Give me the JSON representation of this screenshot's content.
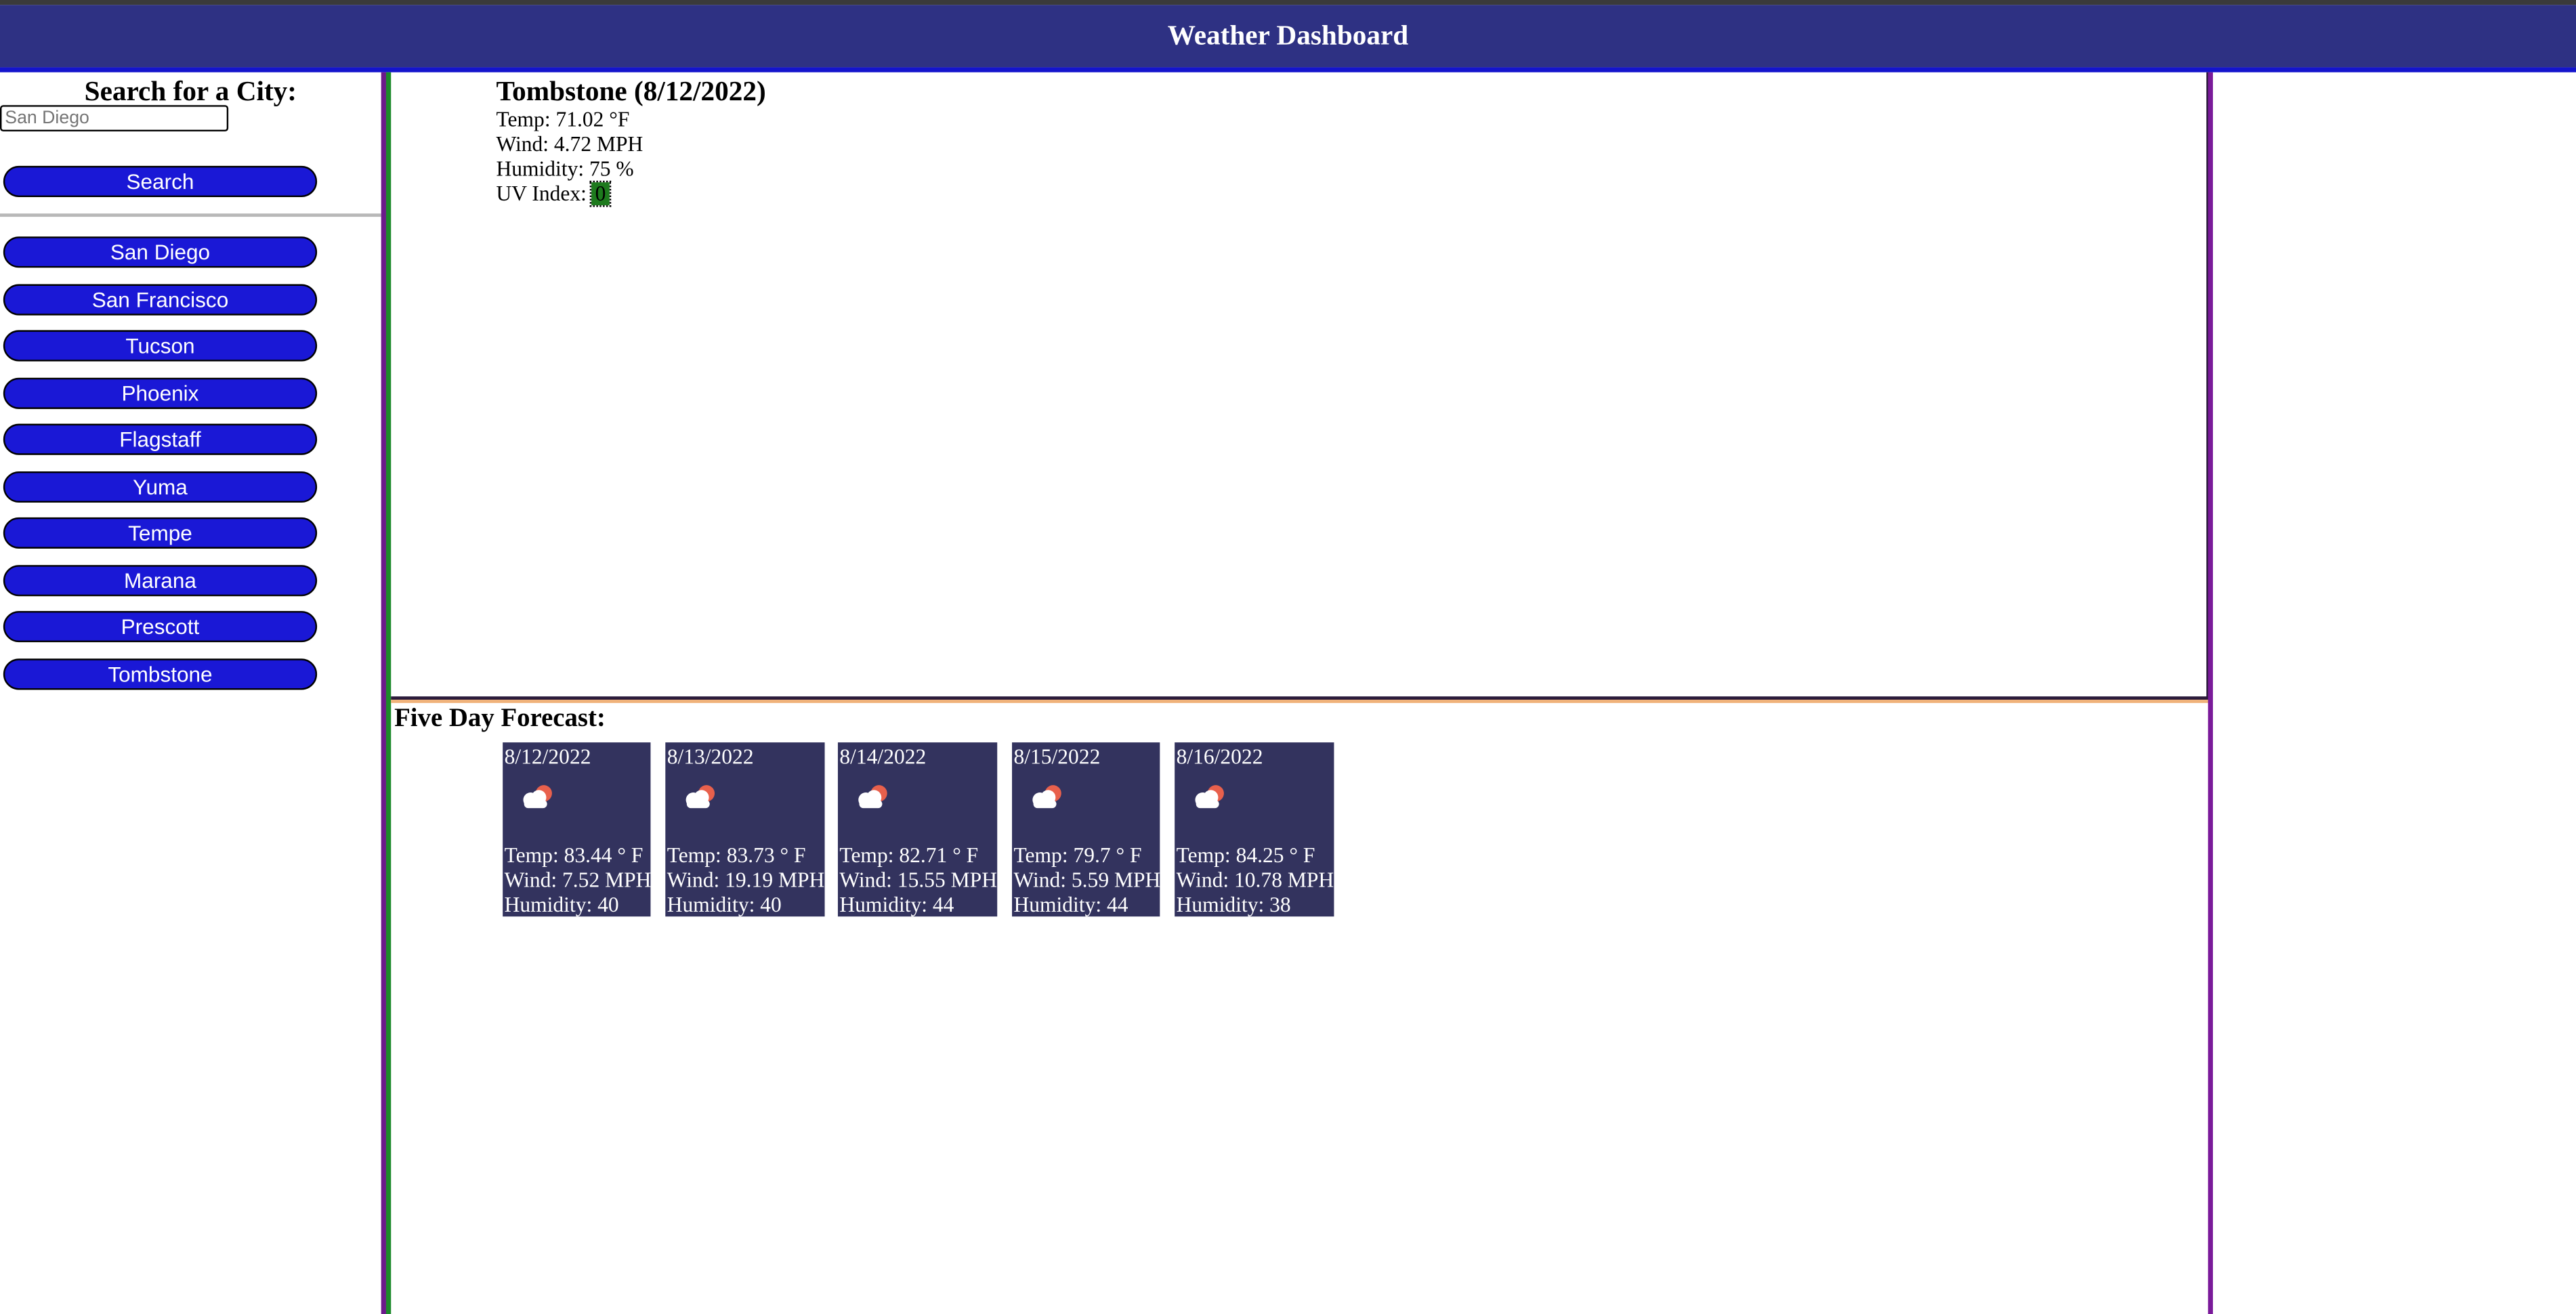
{
  "header": {
    "title": "Weather Dashboard"
  },
  "sidebar": {
    "heading": "Search for a City:",
    "search_placeholder": "San Diego",
    "search_button": "Search",
    "cities": [
      "San Diego",
      "San Francisco",
      "Tucson",
      "Phoenix",
      "Flagstaff",
      "Yuma",
      "Tempe",
      "Marana",
      "Prescott",
      "Tombstone"
    ]
  },
  "current": {
    "title": "Tombstone (8/12/2022)",
    "temp": "Temp: 71.02 °F",
    "wind": "Wind: 4.72 MPH",
    "humidity": "Humidity: 75 %",
    "uv_label": "UV Index: ",
    "uv_value": "0",
    "uv_color": "#1d7a1d"
  },
  "forecast": {
    "title": "Five Day Forecast:",
    "icon": "partly-cloudy-icon",
    "days": [
      {
        "date": "8/12/2022",
        "temp": "Temp: 83.44 ° F",
        "wind": "Wind: 7.52 MPH",
        "humidity": "Humidity: 40"
      },
      {
        "date": "8/13/2022",
        "temp": "Temp: 83.73 ° F",
        "wind": "Wind: 19.19 MPH",
        "humidity": "Humidity: 40"
      },
      {
        "date": "8/14/2022",
        "temp": "Temp: 82.71 ° F",
        "wind": "Wind: 15.55 MPH",
        "humidity": "Humidity: 44"
      },
      {
        "date": "8/15/2022",
        "temp": "Temp: 79.7 ° F",
        "wind": "Wind: 5.59 MPH",
        "humidity": "Humidity: 44"
      },
      {
        "date": "8/16/2022",
        "temp": "Temp: 84.25 ° F",
        "wind": "Wind: 10.78 MPH",
        "humidity": "Humidity: 38"
      }
    ]
  },
  "colors": {
    "header_bg": "#2e3183",
    "button_bg": "#1a18d6",
    "card_bg": "#33335e"
  }
}
